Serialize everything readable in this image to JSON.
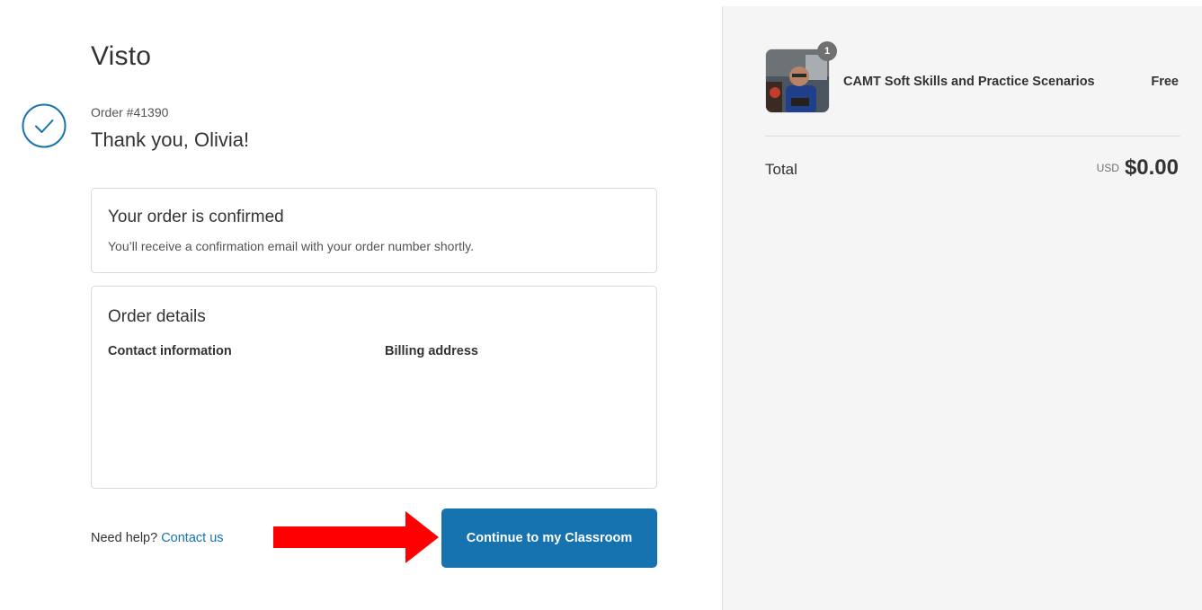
{
  "store": {
    "name": "Visto"
  },
  "order": {
    "number_label": "Order #41390",
    "thank_you": "Thank you, Olivia!"
  },
  "confirmation": {
    "title": "Your order is confirmed",
    "text": "You’ll receive a confirmation email with your order number shortly."
  },
  "details": {
    "title": "Order details",
    "contact_heading": "Contact information",
    "billing_heading": "Billing address"
  },
  "help": {
    "text": "Need help?",
    "link": "Contact us"
  },
  "actions": {
    "continue_label": "Continue to my Classroom"
  },
  "summary": {
    "item": {
      "quantity": "1",
      "name": "CAMT Soft Skills and Practice Scenarios",
      "price": "Free"
    },
    "total_label": "Total",
    "currency": "USD",
    "total_amount": "$0.00"
  },
  "colors": {
    "accent": "#1773b0",
    "arrow": "#ff0000",
    "sidebar_bg": "#f5f5f5"
  },
  "icons": [
    "checkmark-circle-icon",
    "arrow-right-icon"
  ]
}
